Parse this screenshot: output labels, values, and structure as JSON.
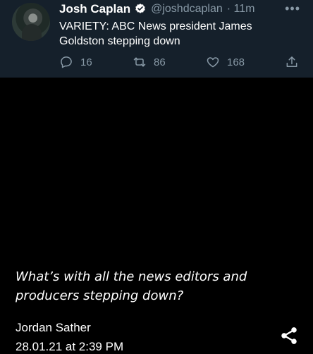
{
  "tweet": {
    "author_name": "Josh Caplan",
    "handle": "@joshdcaplan",
    "time": "· 11m",
    "text": "VARIETY: ABC News president James Goldston stepping down",
    "more_icon": "more-horizontal-icon",
    "verified_color": "#ffffff",
    "actions": {
      "reply_count": "16",
      "retweet_count": "86",
      "like_count": "168"
    }
  },
  "caption": "What’s with all the news editors and producers stepping down?",
  "post": {
    "author": "Jordan Sather",
    "date": "28.01.21 at 2:39 PM"
  },
  "colors": {
    "card_bg": "#15202b",
    "secondary_text": "#8899a6",
    "page_bg": "#000000"
  }
}
